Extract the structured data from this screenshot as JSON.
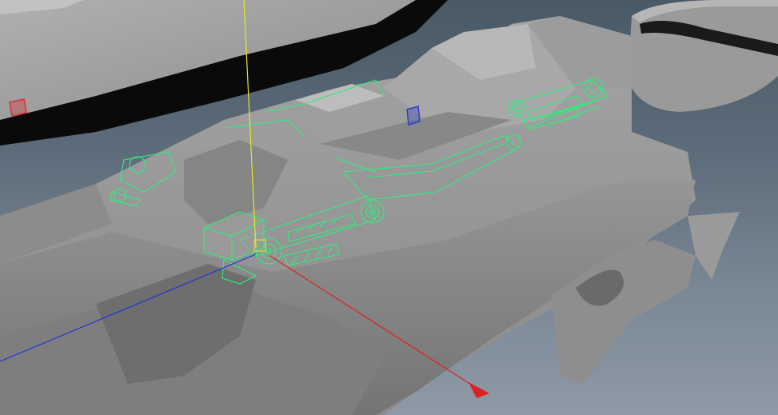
{
  "viewport": {
    "background_top": "#4a5966",
    "background_bottom": "#8e9aa6",
    "model_shade": "#8f8f8f",
    "wireframe_color": "#2cf07c",
    "axes": {
      "x_color": "#e02020",
      "y_color": "#e8e820",
      "z_color": "#2030e0"
    },
    "markers": [
      {
        "name": "red-locator",
        "color": "#d83030"
      },
      {
        "name": "blue-locator",
        "color": "#3040c8"
      }
    ],
    "selected_object": "rig-linkage-assembly",
    "icons": [
      "move-manipulator-icon",
      "locator-icon"
    ]
  }
}
